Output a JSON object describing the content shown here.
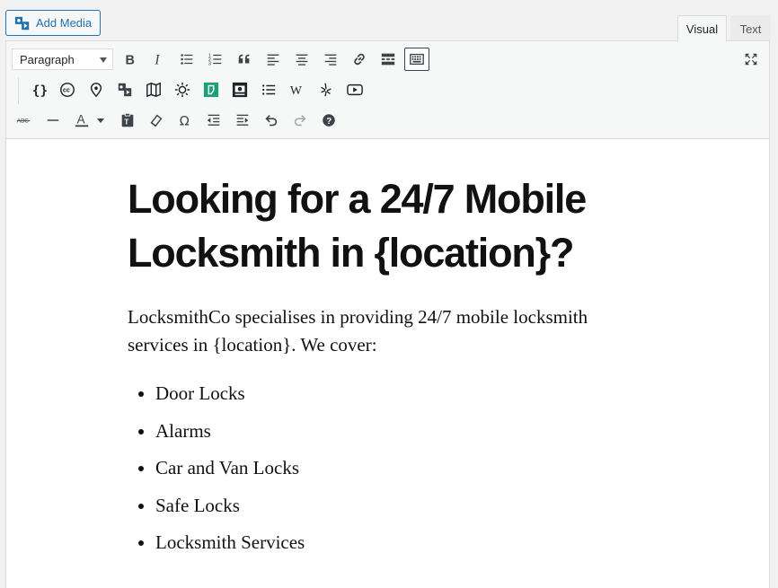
{
  "header": {
    "add_media_label": "Add Media",
    "tabs": [
      {
        "label": "Visual",
        "active": true
      },
      {
        "label": "Text",
        "active": false
      }
    ]
  },
  "toolbar": {
    "format_select_value": "Paragraph",
    "row1_icons": [
      "bold-icon",
      "italic-icon",
      "bullet-list-icon",
      "numbered-list-icon",
      "blockquote-icon",
      "align-left-icon",
      "align-center-icon",
      "align-right-icon",
      "link-icon",
      "read-more-icon",
      "toolbar-toggle-icon"
    ],
    "row2_icons": [
      "shortcode-braces-icon",
      "creative-commons-icon",
      "map-pin-icon",
      "media-gallery-icon",
      "map-icon",
      "sun-icon",
      "plugin-green-icon",
      "camera-badge-icon",
      "list-icon",
      "wikipedia-icon",
      "yelp-icon",
      "youtube-icon"
    ],
    "row3_icons": [
      "strikethrough-icon",
      "horizontal-line-icon",
      "text-color-icon",
      "paste-text-icon",
      "clear-formatting-icon",
      "special-character-icon",
      "outdent-icon",
      "indent-icon",
      "undo-icon",
      "redo-icon",
      "help-icon"
    ],
    "colors": {
      "accent": "#2271b1",
      "icon": "#3c434a",
      "green": "#1aa17a"
    }
  },
  "content": {
    "heading": "Looking for a 24/7 Mobile Locksmith in {location}?",
    "paragraph": "LocksmithCo specialises in providing 24/7 mobile locksmith services in {location}. We cover:",
    "list": [
      "Door Locks",
      "Alarms",
      "Car and Van Locks",
      "Safe Locks",
      "Locksmith Services"
    ]
  }
}
